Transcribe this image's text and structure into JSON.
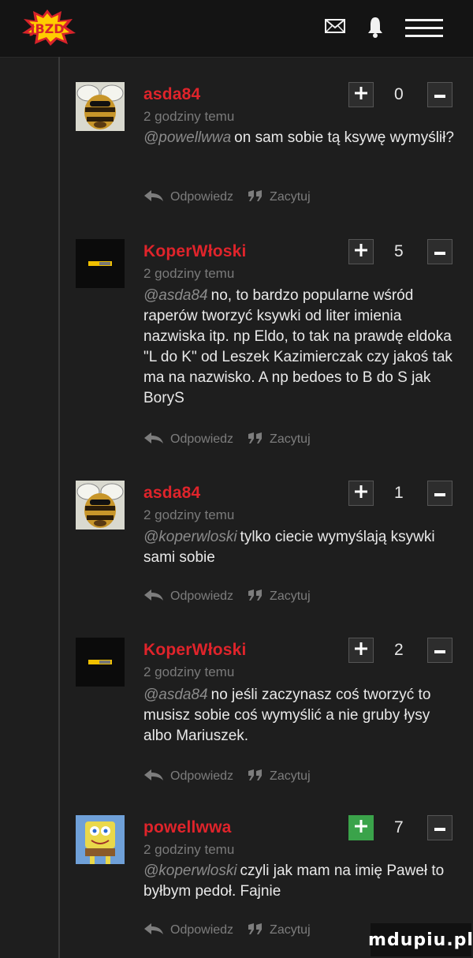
{
  "header": {
    "logo_text": "JBZD",
    "icons": [
      "mail-icon",
      "bell-icon",
      "menu-icon"
    ]
  },
  "colors": {
    "username": "#e0242b",
    "vote_active": "#3aa34a",
    "background": "#1e1e1e"
  },
  "labels": {
    "reply": "Odpowiedz",
    "quote": "Zacytuj"
  },
  "comments": [
    {
      "username": "asda84",
      "time": "2 godziny temu",
      "mention": "@powellwwa",
      "text": "on sam sobie tą ksywę wymyślił?",
      "score": "0",
      "avatar": "bee"
    },
    {
      "username": "KoperWłoski",
      "time": "2 godziny temu",
      "mention": "@asda84",
      "text": "no, to bardzo popularne wśród raperów tworzyć ksywki od liter imienia nazwiska itp. np Eldo, to tak na prawdę eldoka \"L do K\" od Leszek Kazimierczak czy jakoś tak ma na nazwisko. A np bedoes to B do S jak BoryS",
      "score": "5",
      "avatar": "dark"
    },
    {
      "username": "asda84",
      "time": "2 godziny temu",
      "mention": "@koperwloski",
      "text": "tylko ciecie wymyślają ksywki sami sobie",
      "score": "1",
      "avatar": "bee"
    },
    {
      "username": "KoperWłoski",
      "time": "2 godziny temu",
      "mention": "@asda84",
      "text": "no jeśli zaczynasz coś tworzyć to musisz sobie coś wymyślić a nie gruby łysy albo Mariuszek.",
      "score": "2",
      "avatar": "dark"
    },
    {
      "username": "powellwwa",
      "time": "2 godziny temu",
      "mention": "@koperwloski",
      "text": "czyli jak mam na imię Paweł to byłbym pedoł. Fajnie",
      "score": "7",
      "avatar": "sponge",
      "upvoted": true
    }
  ],
  "watermark": "mdupiu.pl"
}
